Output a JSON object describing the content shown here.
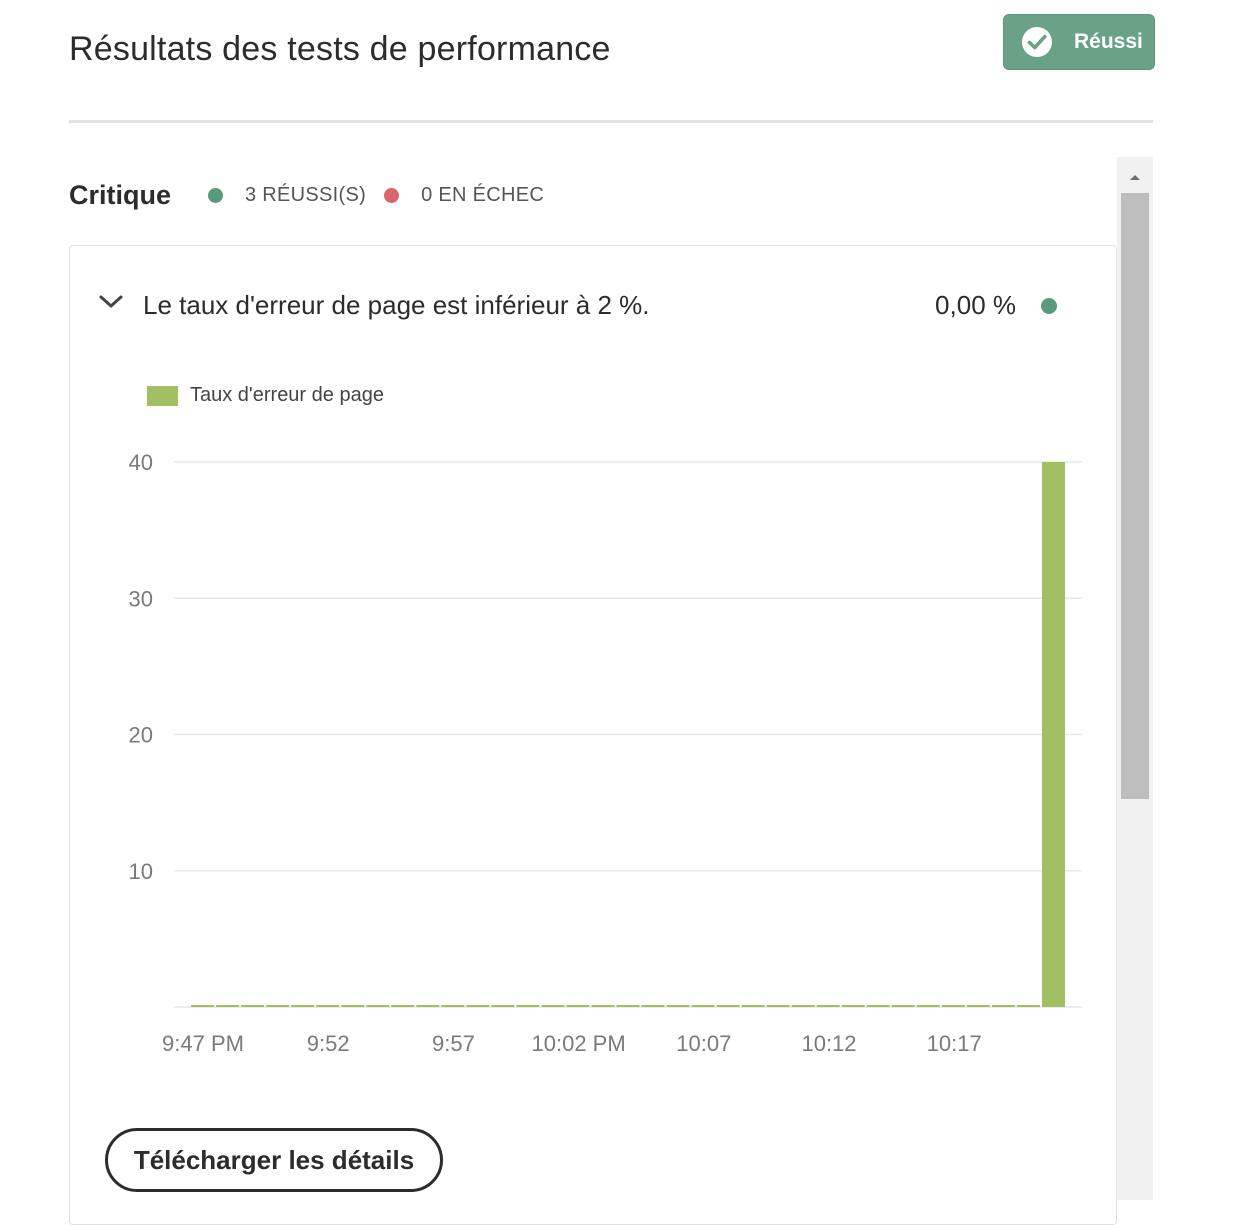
{
  "header": {
    "title": "Résultats des tests de performance",
    "status_label": "Réussi",
    "status_icon": "check-circle-icon",
    "status_color": "#6aa287"
  },
  "section": {
    "title": "Critique",
    "passed_label": "3 RÉUSSI(S)",
    "failed_label": "0 EN ÉCHEC",
    "passed_color": "#5a9a7c",
    "failed_color": "#d9666a"
  },
  "test": {
    "title": "Le taux d'erreur de page est inférieur à 2 %.",
    "value": "0,00 %",
    "status_color": "#5a9a7c",
    "expand_icon": "chevron-down-icon"
  },
  "chart_data": {
    "type": "bar",
    "title": "",
    "xlabel": "",
    "ylabel": "",
    "ylim": [
      0,
      40
    ],
    "yticks": [
      10,
      20,
      30,
      40
    ],
    "grid": true,
    "legend": "top-left",
    "series_color": "#a0c063",
    "series": [
      {
        "name": "Taux d'erreur de page",
        "values": [
          0,
          0,
          0,
          0,
          0,
          0,
          0,
          0,
          0,
          0,
          0,
          0,
          0,
          0,
          0,
          0,
          0,
          0,
          0,
          0,
          0,
          0,
          0,
          0,
          0,
          0,
          0,
          0,
          0,
          0,
          0,
          0,
          0,
          0,
          40
        ]
      }
    ],
    "x_tick_labels": [
      "9:47 PM",
      "9:52",
      "9:57",
      "10:02 PM",
      "10:07",
      "10:12",
      "10:17"
    ]
  },
  "actions": {
    "download_label": "Télécharger les détails"
  }
}
